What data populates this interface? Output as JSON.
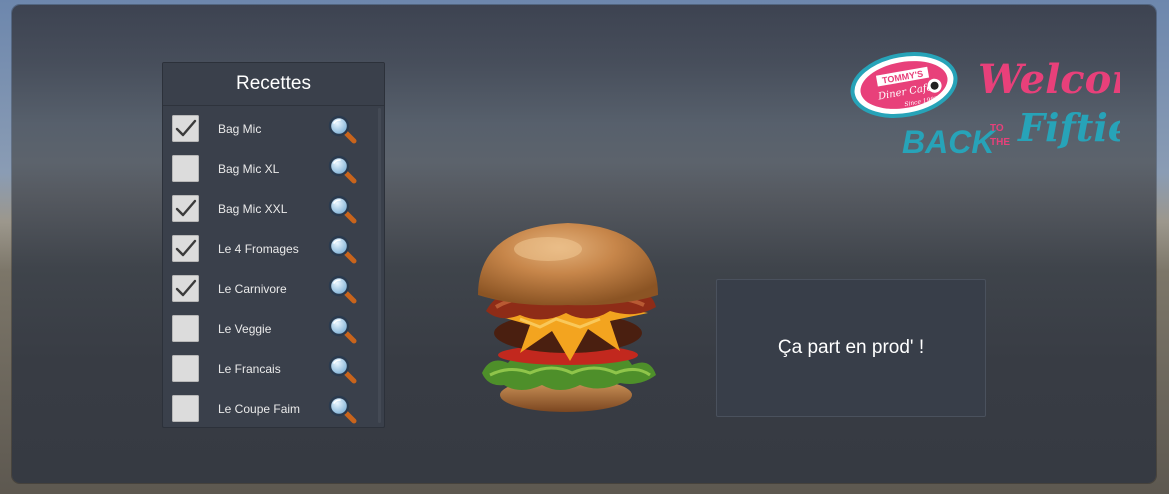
{
  "panel": {
    "title": "Recettes",
    "items": [
      {
        "label": "Bag Mic",
        "checked": true
      },
      {
        "label": "Bag Mic XL",
        "checked": false
      },
      {
        "label": "Bag Mic XXL",
        "checked": true
      },
      {
        "label": "Le 4 Fromages",
        "checked": true
      },
      {
        "label": "Le Carnivore",
        "checked": true
      },
      {
        "label": "Le Veggie",
        "checked": false
      },
      {
        "label": "Le Francais",
        "checked": false
      },
      {
        "label": "Le Coupe Faim",
        "checked": false
      }
    ],
    "item_icon": "magnifier-icon"
  },
  "prod_button": {
    "label": "Ça part en prod' !"
  },
  "logo": {
    "badge_top": "TOMMY'S",
    "badge_mid": "Diner Cafe",
    "badge_since": "Since 1982",
    "welcome": "Welcome",
    "back": "BACK",
    "to": "TO",
    "the": "THE",
    "fifties": "Fifties"
  },
  "colors": {
    "pink": "#e8407a",
    "teal": "#27a3b8",
    "panel_bg": "#3a404b"
  }
}
